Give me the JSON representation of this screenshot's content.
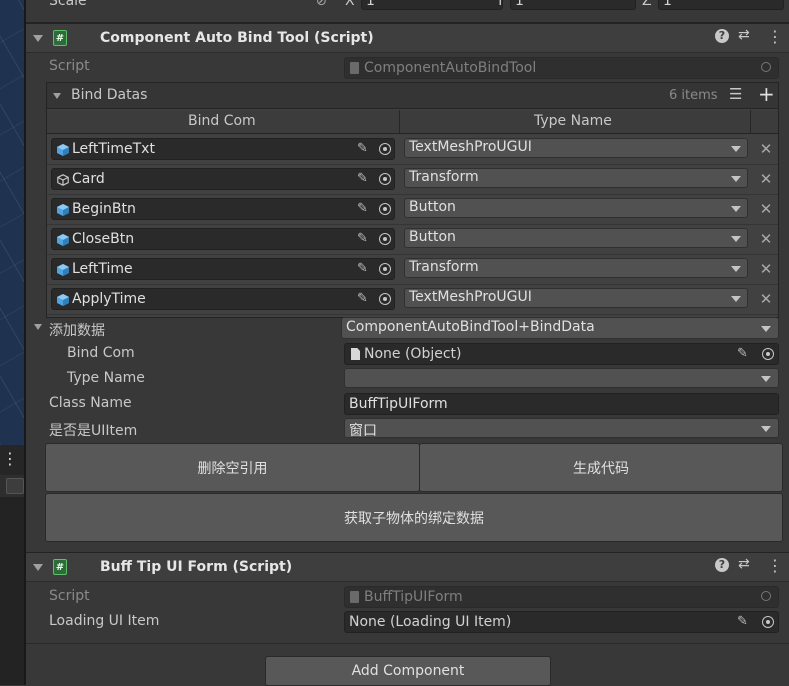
{
  "top": {
    "partial_label": "Scale",
    "axes": [
      "X",
      "Y",
      "Z"
    ],
    "values": [
      "1",
      "1",
      "1"
    ]
  },
  "component1": {
    "title": "Component Auto Bind Tool (Script)",
    "script_label": "Script",
    "script_value": "ComponentAutoBindTool",
    "list": {
      "title": "Bind Datas",
      "count": "6 items",
      "col_bind": "Bind Com",
      "col_type": "Type Name",
      "rows": [
        {
          "name": "LeftTimeTxt",
          "type": "TextMeshProUGUI",
          "icon": "cube-blue-icon"
        },
        {
          "name": "Card",
          "type": "Transform",
          "icon": "cube-outline-icon"
        },
        {
          "name": "BeginBtn",
          "type": "Button",
          "icon": "cube-blue-icon"
        },
        {
          "name": "CloseBtn",
          "type": "Button",
          "icon": "cube-blue-icon"
        },
        {
          "name": "LeftTime",
          "type": "Transform",
          "icon": "cube-blue-icon"
        },
        {
          "name": "ApplyTime",
          "type": "TextMeshProUGUI",
          "icon": "cube-blue-icon"
        }
      ]
    },
    "add_data": {
      "label": "添加数据",
      "value": "ComponentAutoBindTool+BindData"
    },
    "bind_com": {
      "label": "Bind Com",
      "value": "None (Object)"
    },
    "type_name": {
      "label": "Type Name",
      "value": ""
    },
    "class_name": {
      "label": "Class Name",
      "value": "BuffTipUIForm"
    },
    "is_ui_item": {
      "label": "是否是UIItem",
      "value": "窗口"
    },
    "btn_remove_null": "删除空引用",
    "btn_generate": "生成代码",
    "btn_get_child": "获取子物体的绑定数据"
  },
  "component2": {
    "title": "Buff Tip UI Form (Script)",
    "script_label": "Script",
    "script_value": "BuffTipUIForm",
    "loading_label": "Loading UI Item",
    "loading_value": "None (Loading UI Item)"
  },
  "add_component": "Add Component",
  "colors": {
    "cube_blue": "#4fa3e0",
    "script_green": "#5fbf6a",
    "bg": "#383838"
  }
}
